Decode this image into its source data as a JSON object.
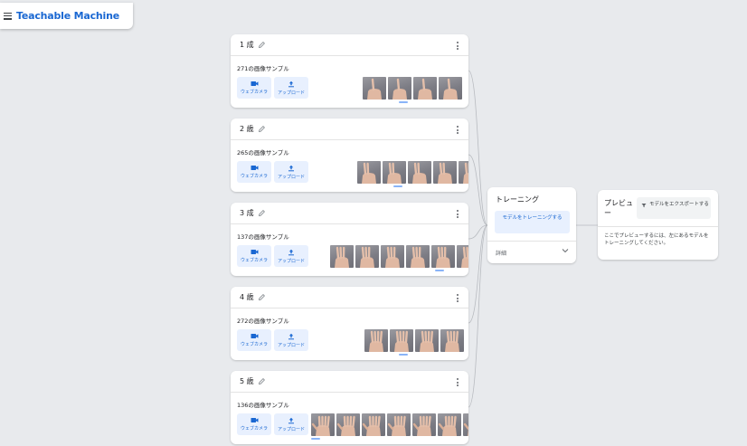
{
  "app": {
    "title": "Teachable Machine"
  },
  "classes": [
    {
      "name": "1 成",
      "samples": "271の画像サンプル",
      "webcam": "ウェブカメラ",
      "upload": "アップロード",
      "fingers": 1
    },
    {
      "name": "2 歳",
      "samples": "265の画像サンプル",
      "webcam": "ウェブカメラ",
      "upload": "アップロード",
      "fingers": 2
    },
    {
      "name": "3 成",
      "samples": "137の画像サンプル",
      "webcam": "ウェブカメラ",
      "upload": "アップロード",
      "fingers": 3
    },
    {
      "name": "4 歳",
      "samples": "272の画像サンプル",
      "webcam": "ウェブカメラ",
      "upload": "アップロード",
      "fingers": 4
    },
    {
      "name": "5 歳",
      "samples": "136の画像サンプル",
      "webcam": "ウェブカメラ",
      "upload": "アップロード",
      "fingers": 5
    }
  ],
  "training": {
    "title": "トレーニング",
    "button": "モデルをトレーニングする",
    "details": "詳細"
  },
  "preview": {
    "title": "プレビュー",
    "export": "モデルをエクスポートする",
    "message": "ここでプレビューするには、左にあるモデルをトレーニングしてください。"
  },
  "icons": [
    "menu-icon",
    "pencil-icon",
    "more-vert-icon",
    "video-camera-icon",
    "upload-icon",
    "chevron-down-icon",
    "export-icon",
    "hand-icon"
  ],
  "colors": {
    "accent": "#1967d2",
    "button_bg": "#e8f0fe",
    "page_bg": "#e8eaed"
  }
}
